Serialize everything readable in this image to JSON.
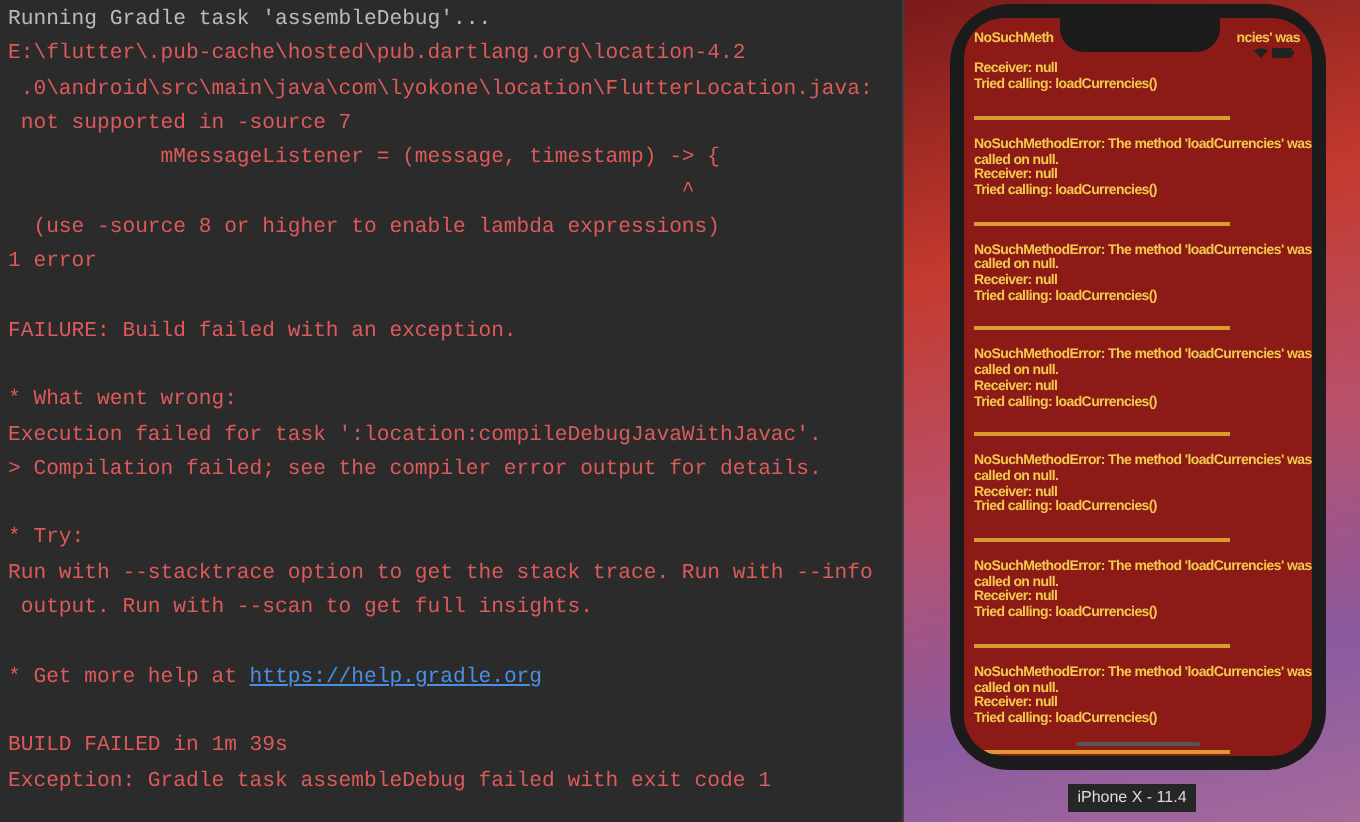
{
  "console": {
    "lines": [
      {
        "kind": "info",
        "text": "Running Gradle task 'assembleDebug'..."
      },
      {
        "kind": "error",
        "text": "E:\\flutter\\.pub-cache\\hosted\\pub.dartlang.org\\location-4.2"
      },
      {
        "kind": "error",
        "text": " .0\\android\\src\\main\\java\\com\\lyokone\\location\\FlutterLocation.java:"
      },
      {
        "kind": "error",
        "text": " not supported in -source 7"
      },
      {
        "kind": "error",
        "text": "            mMessageListener = (message, timestamp) -> {"
      },
      {
        "kind": "error",
        "text": "                                                     ^"
      },
      {
        "kind": "error",
        "text": "  (use -source 8 or higher to enable lambda expressions)"
      },
      {
        "kind": "error",
        "text": "1 error"
      },
      {
        "kind": "blank"
      },
      {
        "kind": "error",
        "text": "FAILURE: Build failed with an exception."
      },
      {
        "kind": "blank"
      },
      {
        "kind": "error",
        "text": "* What went wrong:"
      },
      {
        "kind": "error",
        "text": "Execution failed for task ':location:compileDebugJavaWithJavac'."
      },
      {
        "kind": "error",
        "text": "> Compilation failed; see the compiler error output for details."
      },
      {
        "kind": "blank"
      },
      {
        "kind": "error",
        "text": "* Try:"
      },
      {
        "kind": "error",
        "text": "Run with --stacktrace option to get the stack trace. Run with --info"
      },
      {
        "kind": "error",
        "text": " output. Run with --scan to get full insights."
      },
      {
        "kind": "blank"
      },
      {
        "kind": "link",
        "text": "* Get more help at ",
        "link": "https://help.gradle.org"
      },
      {
        "kind": "blank"
      },
      {
        "kind": "error",
        "text": "BUILD FAILED in 1m 39s"
      },
      {
        "kind": "error",
        "text": "Exception: Gradle task assembleDebug failed with exit code 1"
      }
    ]
  },
  "simulator": {
    "partial_block": {
      "left_fragment": "NoSuchMeth",
      "right_fragment": "ncies' was",
      "receiver": "Receiver: null",
      "tried": "Tried calling: loadCurrencies()"
    },
    "error_blocks": [
      {
        "message": "NoSuchMethodError: The method 'loadCurrencies' was called on null.",
        "receiver": "Receiver: null",
        "tried": "Tried calling: loadCurrencies()"
      },
      {
        "message": "NoSuchMethodError: The method 'loadCurrencies' was called on null.",
        "receiver": "Receiver: null",
        "tried": "Tried calling: loadCurrencies()"
      },
      {
        "message": "NoSuchMethodError: The method 'loadCurrencies' was called on null.",
        "receiver": "Receiver: null",
        "tried": "Tried calling: loadCurrencies()"
      },
      {
        "message": "NoSuchMethodError: The method 'loadCurrencies' was called on null.",
        "receiver": "Receiver: null",
        "tried": "Tried calling: loadCurrencies()"
      },
      {
        "message": "NoSuchMethodError: The method 'loadCurrencies' was called on null.",
        "receiver": "Receiver: null",
        "tried": "Tried calling: loadCurrencies()"
      },
      {
        "message": "NoSuchMethodError: The method 'loadCurrencies' was called on null.",
        "receiver": "Receiver: null",
        "tried": "Tried calling: loadCurrencies()"
      }
    ],
    "device_label": "iPhone X - 11.4"
  }
}
